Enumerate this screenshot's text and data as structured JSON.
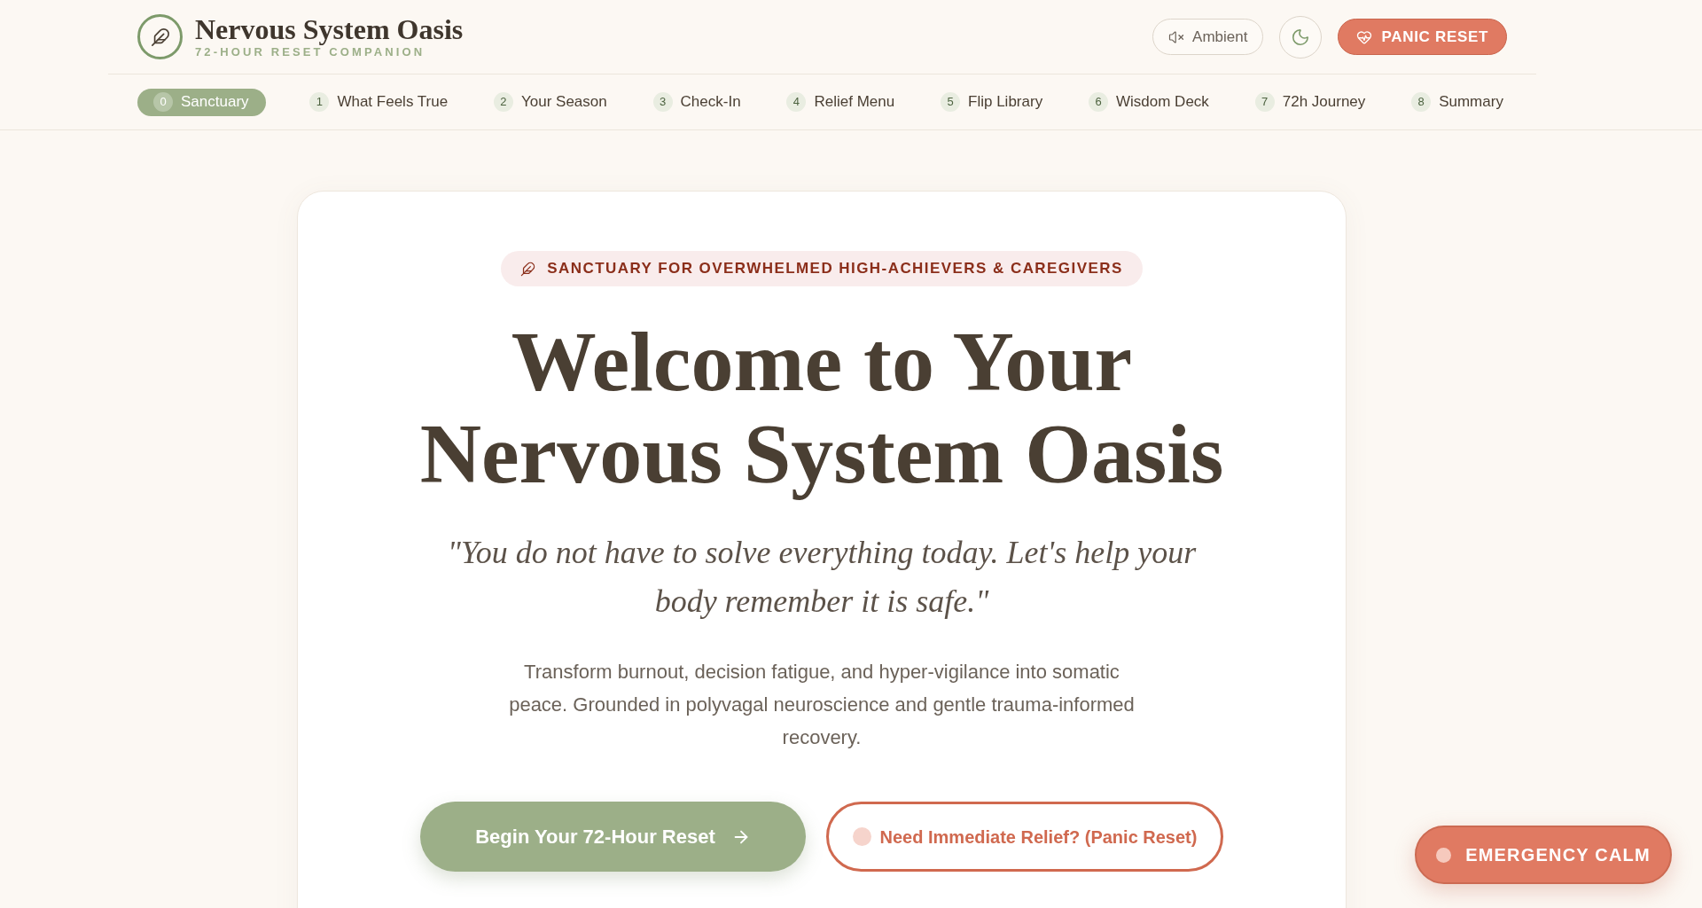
{
  "header": {
    "title": "Nervous System Oasis",
    "subtitle": "72-HOUR RESET COMPANION",
    "ambient_button": {
      "label": "Ambient",
      "muted": true
    },
    "panic_button": {
      "label": "PANIC RESET"
    }
  },
  "nav": {
    "tabs": [
      {
        "number": "0",
        "label": "Sanctuary",
        "selected": true
      },
      {
        "number": "1",
        "label": "What Feels True",
        "selected": false
      },
      {
        "number": "2",
        "label": "Your Season",
        "selected": false
      },
      {
        "number": "3",
        "label": "Check-In",
        "selected": false
      },
      {
        "number": "4",
        "label": "Relief Menu",
        "selected": false
      },
      {
        "number": "5",
        "label": "Flip Library",
        "selected": false
      },
      {
        "number": "6",
        "label": "Wisdom Deck",
        "selected": false
      },
      {
        "number": "7",
        "label": "72h Journey",
        "selected": false
      },
      {
        "number": "8",
        "label": "Summary",
        "selected": false
      }
    ]
  },
  "hero": {
    "badge": "SANCTUARY FOR OVERWHELMED HIGH-ACHIEVERS & CAREGIVERS",
    "heading": "Welcome to Your Nervous System Oasis",
    "quote": "\"You do not have to solve everything today. Let's help your body remember it is safe.\"",
    "description": "Transform burnout, decision fatigue, and hyper-vigilance into somatic peace. Grounded in polyvagal neuroscience and gentle trauma-informed recovery.",
    "primary_button": {
      "label": "Begin Your 72-Hour Reset"
    },
    "secondary_button": {
      "label": "Need Immediate Relief? (Panic Reset)"
    }
  },
  "emergency_button": {
    "label": "EMERGENCY CALM"
  }
}
